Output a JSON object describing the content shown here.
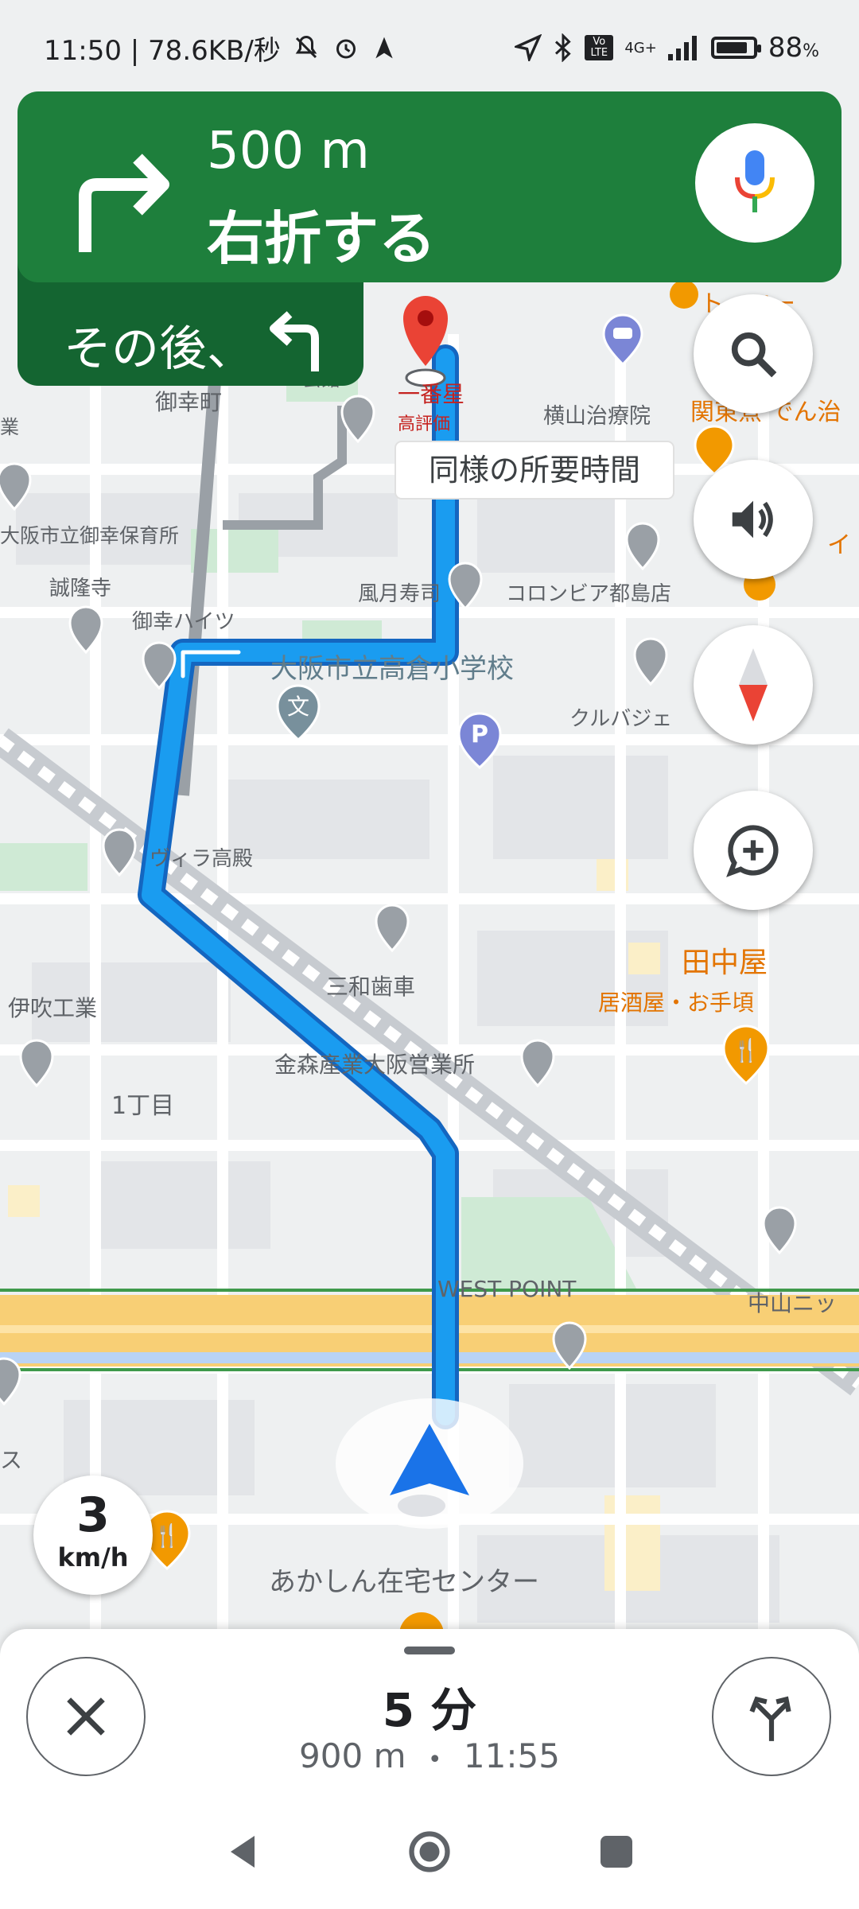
{
  "status_bar": {
    "time_speed": "11:50 | 78.6KB/秒",
    "battery_percent": "88",
    "battery_level": 0.88,
    "network": "4G+",
    "volte": "Vo LTE",
    "icons": [
      "bell-off-icon",
      "alarm-icon",
      "navigation-icon",
      "location-icon",
      "bluetooth-icon",
      "signal-icon",
      "battery-icon"
    ]
  },
  "navigation": {
    "distance": "500 m",
    "instruction": "右折する",
    "then_label": "その後、",
    "turn_icon": "turn-right-icon",
    "then_icon": "turn-left-icon"
  },
  "map_labels": {
    "place_1": "御幸町",
    "place_2": "一番星",
    "place_2_sub": "高評価",
    "place_3": "横山治療院",
    "place_4": "関東煮 でん治",
    "eta_bubble": "同様の所要時間",
    "place_5": "大阪市立御幸保育所",
    "place_6": "誠隆寺",
    "place_7": "風月寿司",
    "place_8": "コロンビア都島店",
    "place_9": "御幸ハイツ",
    "place_10": "大阪市立高倉小学校",
    "place_11": "クルバジェ",
    "place_12": "ヴィラ高殿",
    "place_13": "三和歯車",
    "place_14": "田中屋",
    "place_14_sub": "居酒屋・お手頃",
    "place_15": "伊吹工業",
    "place_16": "金森産業大阪営業所",
    "place_17": "1丁目",
    "place_18": "WEST POINT",
    "place_19": "中山ニッ",
    "place_20": "ス",
    "place_21": "あかしん在宅センター",
    "place_22": "会館",
    "place_23": "業",
    "place_24": "イ",
    "place_25": "ト・コー"
  },
  "controls": {
    "search_icon": "search-icon",
    "sound_icon": "volume-icon",
    "compass_icon": "compass-icon",
    "report_icon": "add-comment-icon"
  },
  "speed": {
    "value": "3",
    "unit": "km/h"
  },
  "trip": {
    "duration": "5 分",
    "distance": "900 m",
    "separator": "•",
    "arrival": "11:55"
  },
  "colors": {
    "nav_green": "#1e7f3c",
    "nav_dark_green": "#146531",
    "route_blue": "#1a9cf0",
    "destination_red": "#ea4335",
    "highway_yellow": "#f8cf75",
    "poi_orange": "#f29900"
  }
}
